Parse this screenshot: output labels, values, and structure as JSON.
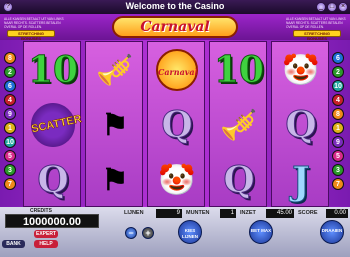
{
  "window": {
    "title": "Welcome to the Casino",
    "left_btn": "?",
    "right_btns": [
      "_",
      "□",
      "×"
    ]
  },
  "logo": "Carnaval",
  "top": {
    "fineprint_left": "ALLE KANSEN BETAALT UIT VAN LINKS NAAR RECHTS. SCATTERS BETALEN OVERAL OP DE ROLLEN.",
    "fineprint_right": "ALLE KANSEN BETAALT UIT VAN LINKS NAAR RECHTS. SCATTERS BETALEN OVERAL OP DE ROLLEN.",
    "tag_left": "STRETCHING BONUSES",
    "tag_right": "STRETCHING BONUSES"
  },
  "paylines_left": [
    {
      "num": "8",
      "color": "#f08a1a"
    },
    {
      "num": "2",
      "color": "#2b9a2b"
    },
    {
      "num": "6",
      "color": "#1e6fd8"
    },
    {
      "num": "4",
      "color": "#c8202a"
    },
    {
      "num": "9",
      "color": "#7a2bbd"
    },
    {
      "num": "1",
      "color": "#e0b21a"
    },
    {
      "num": "10",
      "color": "#20a7a0"
    },
    {
      "num": "5",
      "color": "#d82a8a"
    },
    {
      "num": "3",
      "color": "#2b9a2b"
    },
    {
      "num": "7",
      "color": "#f08a1a"
    }
  ],
  "paylines_right": [
    {
      "num": "6",
      "color": "#1e6fd8"
    },
    {
      "num": "2",
      "color": "#2b9a2b"
    },
    {
      "num": "10",
      "color": "#20a7a0"
    },
    {
      "num": "4",
      "color": "#c8202a"
    },
    {
      "num": "8",
      "color": "#f08a1a"
    },
    {
      "num": "1",
      "color": "#e0b21a"
    },
    {
      "num": "9",
      "color": "#7a2bbd"
    },
    {
      "num": "5",
      "color": "#d82a8a"
    },
    {
      "num": "3",
      "color": "#2b9a2b"
    },
    {
      "num": "7",
      "color": "#f08a1a"
    }
  ],
  "reels": [
    [
      {
        "type": "ten",
        "icon": "ten-symbol",
        "text": "10"
      },
      {
        "type": "scatter",
        "icon": "scatter-symbol",
        "text": "SCATTER"
      },
      {
        "type": "queen",
        "icon": "queen-symbol",
        "text": "Q"
      }
    ],
    [
      {
        "type": "trumpet",
        "icon": "trumpet-icon",
        "text": "🎺"
      },
      {
        "type": "flag",
        "icon": "flag-icon",
        "text": "⚑"
      },
      {
        "type": "flag",
        "icon": "flag-icon",
        "text": "⚑"
      }
    ],
    [
      {
        "type": "logo",
        "icon": "carnaval-logo-symbol",
        "text": "Carnaval"
      },
      {
        "type": "queen",
        "icon": "queen-symbol",
        "text": "Q"
      },
      {
        "type": "clown",
        "icon": "clown-icon",
        "text": "🤡"
      }
    ],
    [
      {
        "type": "ten",
        "icon": "ten-symbol",
        "text": "10"
      },
      {
        "type": "trumpet",
        "icon": "trumpet-icon",
        "text": "🎺"
      },
      {
        "type": "queen",
        "icon": "queen-symbol",
        "text": "Q"
      }
    ],
    [
      {
        "type": "clown",
        "icon": "clown-icon",
        "text": "🤡"
      },
      {
        "type": "queen",
        "icon": "queen-symbol",
        "text": "Q"
      },
      {
        "type": "jack",
        "icon": "jack-symbol",
        "text": "J"
      }
    ]
  ],
  "bottom": {
    "credits_label": "CREDITS",
    "credits_value": "1000000.00",
    "expert": "EXPERT",
    "bank": "BANK",
    "help": "HELP",
    "lijnen_label": "LIJNEN",
    "lijnen_value": "9",
    "munten_label": "MUNTEN",
    "munten_value": "1",
    "inzet_label": "INZET",
    "inzet_value": "45.00",
    "score_label": "SCORE",
    "score_value": "0.00",
    "minus": "−",
    "plus": "+",
    "kies_lijnen": "KIES LIJNEN",
    "bet_max": "BET MAX",
    "draaien": "DRAAIEN"
  }
}
